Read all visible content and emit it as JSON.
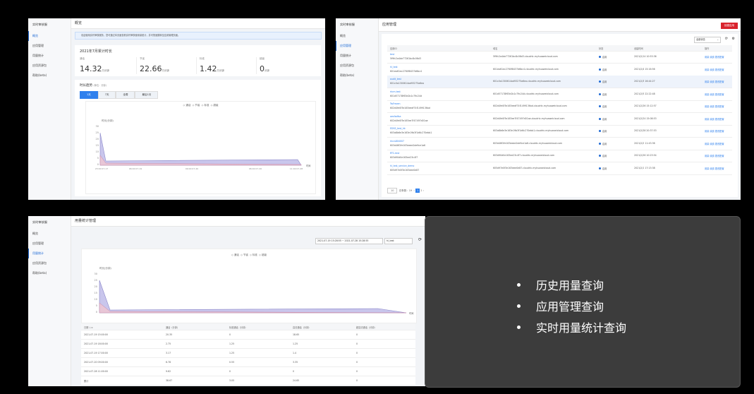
{
  "p1": {
    "sidebar_title": "实时审核服",
    "sidebar": [
      "概览",
      "应用管理",
      "用量统计",
      "应用资源包",
      "帮助(beta)"
    ],
    "header": "概览",
    "notice": "欢迎使用实时审核服务，您可通过本页面查看实时审核使用量统计，并可快速跳转至应用管理页面。",
    "card_title": "2021年7月累计时长",
    "stats": [
      {
        "label": "通话",
        "value": "14.32",
        "unit": "万分钟"
      },
      {
        "label": "节省",
        "value": "22.66",
        "unit": "万分钟"
      },
      {
        "label": "标准",
        "value": "1.42",
        "unit": "万分钟"
      },
      {
        "label": "超级",
        "value": "0",
        "unit": "分钟"
      }
    ],
    "trend_title": "时长趋势",
    "trend_unit": "(单位：分钟)",
    "tabs": [
      "1天",
      "7天",
      "全周",
      "最后1月"
    ],
    "legend": [
      "通话",
      "节省",
      "标准",
      "超级"
    ],
    "y_label": "时长(分钟)",
    "y_ticks": [
      "30",
      "25",
      "20",
      "15",
      "10",
      "5",
      "0"
    ],
    "x_ticks": [
      "23:00\n07-17",
      "06:00\n07-19",
      "09:00\n07-20",
      "06:00\n07-20",
      "11:00\n07-28"
    ],
    "x_axis_name": "时间"
  },
  "p2": {
    "sidebar": [
      "概览",
      "应用管理",
      "用量统计",
      "应用资源包",
      "帮助(beta)"
    ],
    "header": "应用管理",
    "create_button": "创建应用",
    "filter": "全部状态",
    "columns": [
      "应用ID",
      "域名",
      "状态",
      "创建时间",
      "操作"
    ],
    "rows": [
      {
        "name": "test",
        "id": "5f9fc2a4de77261bc8c06d3",
        "domain": "5f9fc2a4de77261bc8c06d3.cloudrtc.myhuaweicloud.com",
        "status": "启用",
        "time": "2021/2/14 10:53:36",
        "ops": "用量  续费  更改配置"
      },
      {
        "name": "hl_test",
        "id": "601ea61ec2760f8437d6bc4",
        "domain": "601ea61ec2760f8437d6bc4.cloudrtc.myhuaweicloud.com",
        "status": "启用",
        "time": "2021/2/4 15:16:56",
        "ops": "用量  续费  更改配置"
      },
      {
        "name": "audit_test",
        "id": "601c0a1300614ad93275a6ea",
        "domain": "601c0a1300614ad93275a6ea.cloudrtc.myhuaweicloud.com",
        "status": "启用",
        "time": "2021/2/3 16:44:27",
        "ops": "用量  续费  更改配置"
      },
      {
        "name": "rtcm-test",
        "id": "601d57178f63e2b1c79c24d",
        "domain": "601d57178f63e2b1c79c24d.cloudrtc.myhuaweicloud.com",
        "status": "启用",
        "time": "2021/2/5 22:22:48",
        "ops": "用量  续费  更改配置"
      },
      {
        "name": "TwFrezen",
        "id": "602d4fe0f3e163eedf74f1499136ad",
        "domain": "602d4fe0f3e163eedf74f1499136ad.cloudrtc.myhuaweicloud.com",
        "status": "启用",
        "time": "2021/2/26 15:12:57",
        "ops": "用量  续费  更改配置"
      },
      {
        "name": "aesfadfsa",
        "id": "602d4fe0f3e163ee7f47497d01ae",
        "domain": "602d4fe0f3e163ee7f47497d01ae.cloudrtc.myhuaweicloud.com",
        "status": "启用",
        "time": "2021/2/24 15:08:53",
        "ops": "用量  续费  更改配置"
      },
      {
        "name": "EDSS_test_hk",
        "id": "603a8b6e3e163e19b3f1d6c270ebb1",
        "domain": "603a8b6e3e163e19b3f1d6c270ebb1.cloudrtc.myhuaweicloud.com",
        "status": "启用",
        "time": "2021/2/28 20:37:53",
        "ops": "用量  续费  更改配置"
      },
      {
        "name": "rtccs804007",
        "id": "603d46f2fe163eeee2de9ce1a6",
        "domain": "603d46f2fe163eeee2de9ce1a6.cloudrtc.myhuaweicloud.com",
        "status": "启用",
        "time": "2021/2/2 11:43:36",
        "ops": "用量  续费  更改配置"
      },
      {
        "name": "RTC-test",
        "id": "603d90d0e163ee23c4f7",
        "domain": "603d90d0e163ee23c4f7.cloudrtc.myhuaweicloud.com",
        "status": "启用",
        "time": "2021/2/26 10:23:54",
        "ops": "用量  续费  更改配置"
      },
      {
        "name": "hl_test_service_demo",
        "id": "605d97e0f3e163eee0e87",
        "domain": "605d97e0f3e163eee0e87.cloudrtc.myhuaweicloud.com",
        "status": "启用",
        "time": "2021/2/1 17:13:38",
        "ops": "用量  续费  更改配置"
      }
    ],
    "page_size": "10",
    "total": "总条数：19",
    "pages": [
      "1",
      "2"
    ]
  },
  "p3": {
    "sidebar": [
      "概览",
      "应用管理",
      "用量统计",
      "应用资源包",
      "帮助(beta)"
    ],
    "header": "用量统计管理",
    "date_range": "2021-07-19 15:28:55 ~ 2021-07-28 15:28:55",
    "app_select": "hl_test",
    "legend": [
      "通话",
      "节省",
      "标准",
      "超级"
    ],
    "y_label": "时长(分钟)",
    "y_ticks": [
      "30",
      "25",
      "20",
      "15",
      "10",
      "5",
      "0"
    ],
    "x_axis_name": "时间",
    "columns": [
      "日期 ↓≡",
      "通话（分钟）",
      "标准通话（分钟）",
      "高清通话（分钟）",
      "超高清通话（分钟）"
    ],
    "rows": [
      [
        "2021-07-19 15:00:00",
        "20.35",
        "0",
        "18.65",
        "0"
      ],
      [
        "2021-07-19 18:00:00",
        "2.75",
        "1.25",
        "1.25",
        "0"
      ],
      [
        "2021-07-19 17:00:00",
        "3.17",
        "1.25",
        "1.4",
        "0"
      ],
      [
        "2021-07-20 09:00:00",
        "6.78",
        "0.55",
        "3.35",
        "0"
      ],
      [
        "2021-07-28 11:00:00",
        "9.62",
        "0",
        "0",
        "0"
      ],
      [
        "累计",
        "38.67",
        "3.05",
        "24.65",
        "0"
      ]
    ]
  },
  "bullets": [
    "历史用量查询",
    "应用管理查询",
    "实时用量统计查询"
  ],
  "colors": {
    "accent": "#2f80ed",
    "danger": "#d9232d",
    "chart_fill": "#c9c6ec",
    "chart_line": "#8a87c9"
  }
}
